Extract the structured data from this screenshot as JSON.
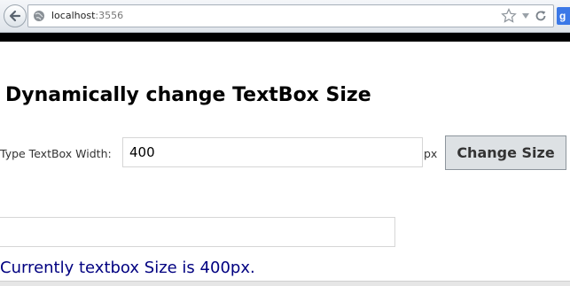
{
  "browser": {
    "url_host": "localhost",
    "url_port": ":3556",
    "search_engine_letter": "g"
  },
  "page": {
    "title": "Dynamically change TextBox Size",
    "width_label": "Type TextBox Width:",
    "width_value": "400",
    "unit_label": "px",
    "button_label": "Change Size",
    "resized_textbox_value": "",
    "status_message": "Currently textbox Size is 400px."
  },
  "colors": {
    "status_text": "#000080",
    "button_bg": "#dde1e4"
  },
  "icons": [
    "back-arrow-icon",
    "globe-icon",
    "star-icon",
    "dropdown-icon",
    "refresh-icon",
    "search-engine-icon"
  ]
}
